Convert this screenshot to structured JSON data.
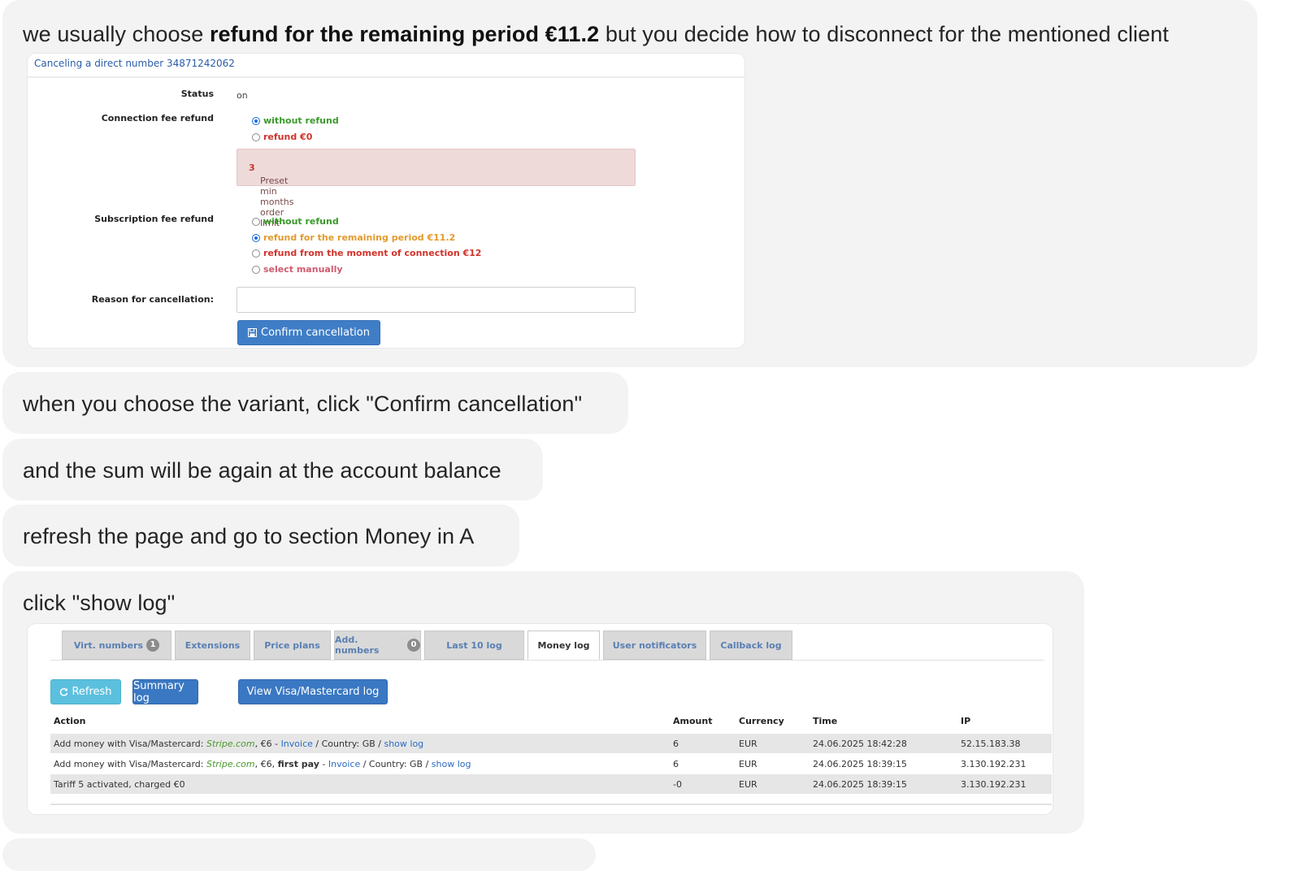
{
  "messages": [
    {
      "text_before": "we usually choose ",
      "text_bold": "refund for the remaining period €11.2",
      "text_after": " but you decide how to disconnect for the mentioned client"
    },
    {
      "text": "when you choose the variant, click \"Confirm cancellation\""
    },
    {
      "text": "and the sum will be again at the account balance"
    },
    {
      "text": "refresh the page and go to section Money in A"
    },
    {
      "text": "click \"show log\""
    }
  ],
  "cancel_form": {
    "title": "Canceling a direct number 34871242062",
    "status_label": "Status",
    "status_value": "on",
    "connection_label": "Connection fee refund",
    "connection_options": [
      {
        "label": "without refund",
        "selected": true
      },
      {
        "label": "refund €0",
        "selected": false
      }
    ],
    "alert_text": "Preset min months order limit - ",
    "alert_value": "3",
    "subscription_label": "Subscription fee refund",
    "subscription_options": [
      {
        "label": "without refund",
        "selected": false
      },
      {
        "label": "refund for the remaining period €11.2",
        "selected": true
      },
      {
        "label": "refund from the moment of connection €12",
        "selected": false
      },
      {
        "label": "select manually",
        "selected": false
      }
    ],
    "reason_label": "Reason for cancellation:",
    "reason_value": "",
    "confirm_button": "Confirm cancellation"
  },
  "money_log": {
    "tabs": [
      {
        "label": "Virt. numbers",
        "count": "1"
      },
      {
        "label": "Extensions"
      },
      {
        "label": "Price plans"
      },
      {
        "label": "Add. numbers",
        "count": "0"
      },
      {
        "label": "Last 10 log"
      },
      {
        "label": "Money log",
        "active": true
      },
      {
        "label": "User notificators"
      },
      {
        "label": "Callback log"
      }
    ],
    "buttons": {
      "refresh": "Refresh",
      "summary": "Summary log",
      "visa": "View Visa/Mastercard log"
    },
    "columns": [
      "Action",
      "Amount",
      "Currency",
      "Time",
      "IP"
    ],
    "rows": [
      {
        "action_prefix": "Add money with Visa/Mastercard: ",
        "action_provider": "Stripe.com",
        "action_mid": ", €6",
        "action_bold": "",
        "action_dash": " - ",
        "action_invoice": "Invoice",
        "action_country": " / Country: GB / ",
        "action_log": "show log",
        "amount": "6",
        "currency": "EUR",
        "time": "24.06.2025 18:42:28",
        "ip": "52.15.183.38"
      },
      {
        "action_prefix": "Add money with Visa/Mastercard: ",
        "action_provider": "Stripe.com",
        "action_mid": ", €6, ",
        "action_bold": "first pay",
        "action_dash": " - ",
        "action_invoice": "Invoice",
        "action_country": " / Country: GB / ",
        "action_log": "show log",
        "amount": "6",
        "currency": "EUR",
        "time": "24.06.2025 18:39:15",
        "ip": "3.130.192.231"
      },
      {
        "action_text": "Tariff 5 activated, charged €0",
        "amount": "-0",
        "currency": "EUR",
        "time": "24.06.2025 18:39:15",
        "ip": "3.130.192.231"
      }
    ]
  }
}
